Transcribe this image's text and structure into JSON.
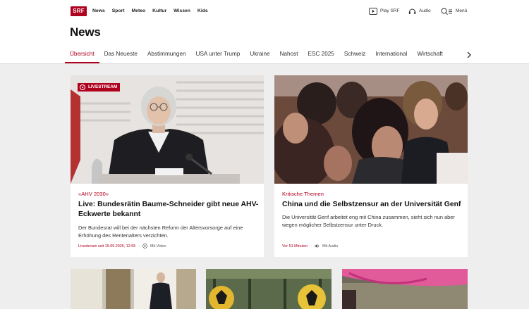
{
  "header": {
    "logo": "SRF",
    "nav": [
      "News",
      "Sport",
      "Meteo",
      "Kultur",
      "Wissen",
      "Kids"
    ],
    "play_srf": "Play SRF",
    "audio": "Audio",
    "menu": "Menü"
  },
  "page_title": "News",
  "tabs": [
    "Übersicht",
    "Das Neueste",
    "Abstimmungen",
    "USA unter Trump",
    "Ukraine",
    "Nahost",
    "ESC 2025",
    "Schweiz",
    "International",
    "Wirtschaft"
  ],
  "articles": [
    {
      "badge": "LIVESTREAM",
      "kicker": "«AHV 2030»",
      "title": "Live: Bundesrätin Baume-Schneider gibt neue AHV-Eckwerte bekannt",
      "lead": "Der Bundesrat will bei der nächsten Reform der Altersvorsorge auf eine Erhöhung des Rentenalters verzichten.",
      "meta_time": "Livestream seit 15.05.2025, 12:55",
      "meta_media": "Mit Video"
    },
    {
      "kicker": "Kritische Themen",
      "title": "China und die Selbstzensur an der Universität Genf",
      "lead": "Die Universität Genf arbeitet eng mit China zusammen, sieht sich nun aber wegen möglicher Selbstzensur unter Druck.",
      "meta_time": "Vor 51 Minuten",
      "meta_media": "Mit Audio"
    }
  ],
  "colors": {
    "accent": "#af001e",
    "background": "#eeeeee"
  }
}
